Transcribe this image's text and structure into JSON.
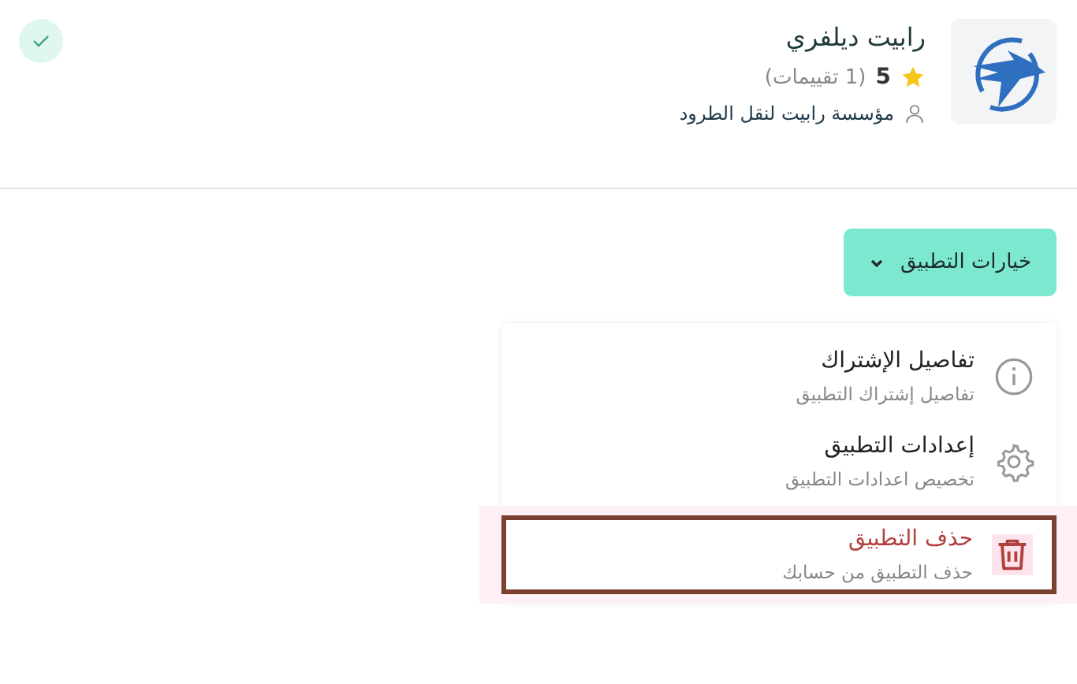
{
  "app": {
    "name": "رابيت ديلفري",
    "rating": "5",
    "reviews": "(1 تقييمات)",
    "stars": 1,
    "company": "مؤسسة رابيت لنقل الطرود",
    "installed": true
  },
  "options_button": {
    "label": "خيارات التطبيق",
    "expanded": true
  },
  "menu": [
    {
      "kind": "info",
      "title": "تفاصيل الإشتراك",
      "subtitle": "تفاصيل إشتراك التطبيق",
      "selected": false
    },
    {
      "kind": "settings",
      "title": "إعدادات التطبيق",
      "subtitle": "تخصيص اعدادات التطبيق",
      "selected": false
    },
    {
      "kind": "delete",
      "title": "حذف التطبيق",
      "subtitle": "حذف التطبيق من حسابك",
      "selected": true
    }
  ]
}
